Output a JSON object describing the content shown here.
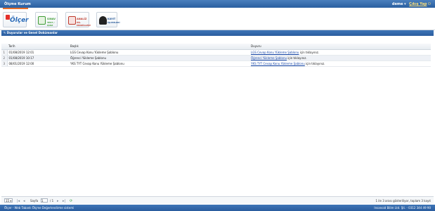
{
  "header": {
    "title": "Ölçme Kurum",
    "user": "deme",
    "user_caret": "▾",
    "logout": "Çıkış Yap",
    "logout_icon": "power-icon"
  },
  "toolbar": {
    "logo_text": "Ölçer",
    "items": [
      {
        "label_line1": "SINAV",
        "label_line2": "TEST / QUIZ",
        "icon": "exam-icon",
        "color": "#3f9c35"
      },
      {
        "label_line1": "ANALİZ",
        "label_line2": "ÖĞ. MODÜLLERİ",
        "icon": "analysis-icon",
        "color": "#c0392b"
      },
      {
        "label_line1": "KAYIT",
        "label_line2": "İŞLEMLERİ",
        "icon": "graduate-icon",
        "color": "#d1a12a"
      }
    ]
  },
  "panel": {
    "title": "Duyurular ve Genel Dokümanlar",
    "icon": "edit-icon"
  },
  "grid": {
    "columns": [
      "",
      "Tarih",
      "Başlık",
      "Duyuru"
    ],
    "rows": [
      {
        "n": "1",
        "date": "01/08/2019 12:01",
        "title": "LGS Cevap Konu Yükleme Şablonu",
        "link": "LGS Cevap Konu Yükleme Şablonu",
        "suffix": "için tıklayınız."
      },
      {
        "n": "2",
        "date": "01/08/2019 10:17",
        "title": "Öğrenci Yükleme Şablonu",
        "link": "Öğrenci Yükleme Şablonu",
        "suffix": "için tıklayınız."
      },
      {
        "n": "3",
        "date": "08/01/2019 12:00",
        "title": "YKS TYT Cevap Konu Yükleme Şablonu",
        "link": "YKS TYT Cevap Konu Yükleme Şablonu",
        "suffix": "için tıklayınız."
      }
    ]
  },
  "pager": {
    "page_size": "15",
    "page_label": "Sayfa",
    "page_value": "1",
    "of_label": "/ 1",
    "summary": "1 ile 3 arası gösteriliyor, toplam 3 kayıt"
  },
  "status": {
    "left": "Ölçer - Web Tabanlı Ölçme Değerlendirme sistemi",
    "right": "Insanoid Bilim Ltd. Şti. - 0312 344 49 90"
  }
}
